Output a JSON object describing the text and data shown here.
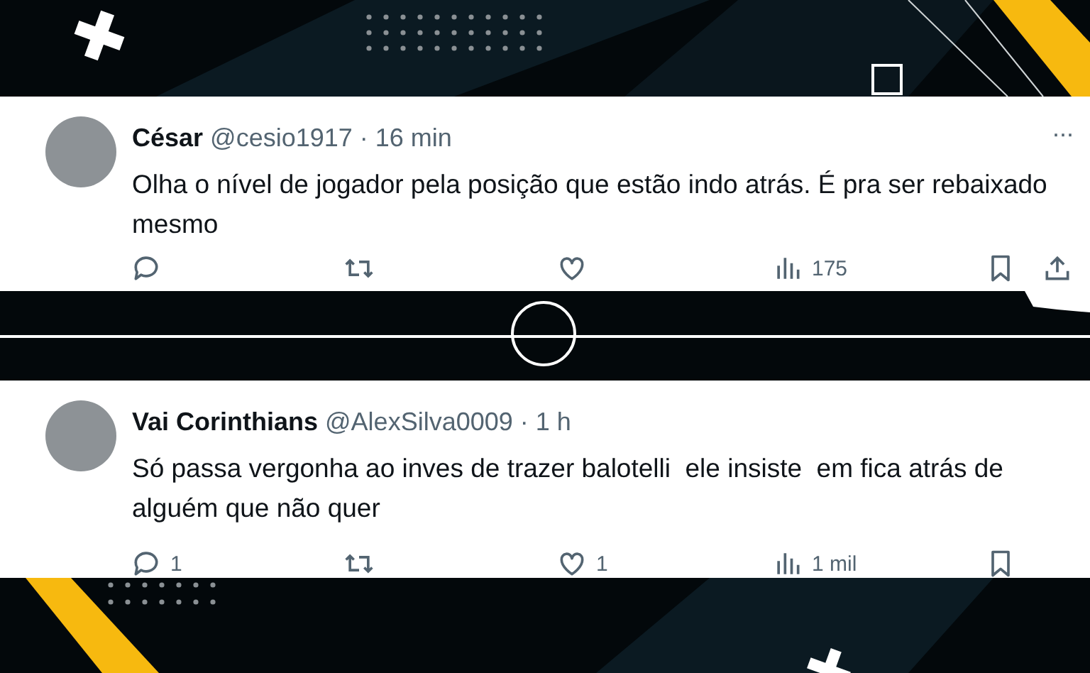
{
  "tweets": [
    {
      "name": "César",
      "handle": "@cesio1917",
      "separator": "·",
      "time": "16 min",
      "text": "Olha o nível de jogador pela posição que estão indo atrás. É pra ser rebaixado mesmo",
      "menu": "···",
      "actions": [
        {
          "kind": "reply"
        },
        {
          "kind": "retweet"
        },
        {
          "kind": "like"
        },
        {
          "kind": "views",
          "count": "175"
        },
        {
          "kind": "bookmark"
        },
        {
          "kind": "share"
        }
      ]
    },
    {
      "name": "Vai Corinthians",
      "handle": "@AlexSilva0009",
      "separator": "·",
      "time": "1 h",
      "text": "Só passa vergonha ao inves de trazer balotelli  ele insiste  em fica atrás de alguém que não quer",
      "actions": [
        {
          "kind": "reply",
          "count": "1"
        },
        {
          "kind": "retweet"
        },
        {
          "kind": "like",
          "count": "1"
        },
        {
          "kind": "views",
          "count": "1 mil"
        },
        {
          "kind": "bookmark"
        }
      ]
    }
  ]
}
